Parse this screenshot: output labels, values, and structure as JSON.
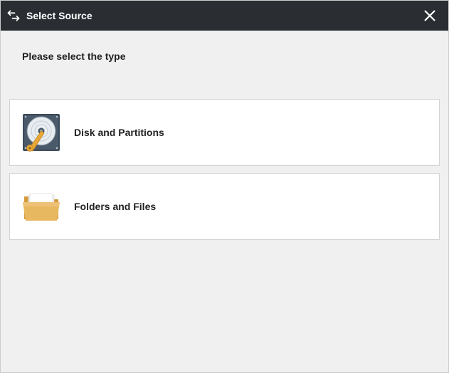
{
  "titlebar": {
    "title": "Select Source"
  },
  "content": {
    "prompt": "Please select the type",
    "options": [
      {
        "label": "Disk and Partitions"
      },
      {
        "label": "Folders and Files"
      }
    ]
  }
}
